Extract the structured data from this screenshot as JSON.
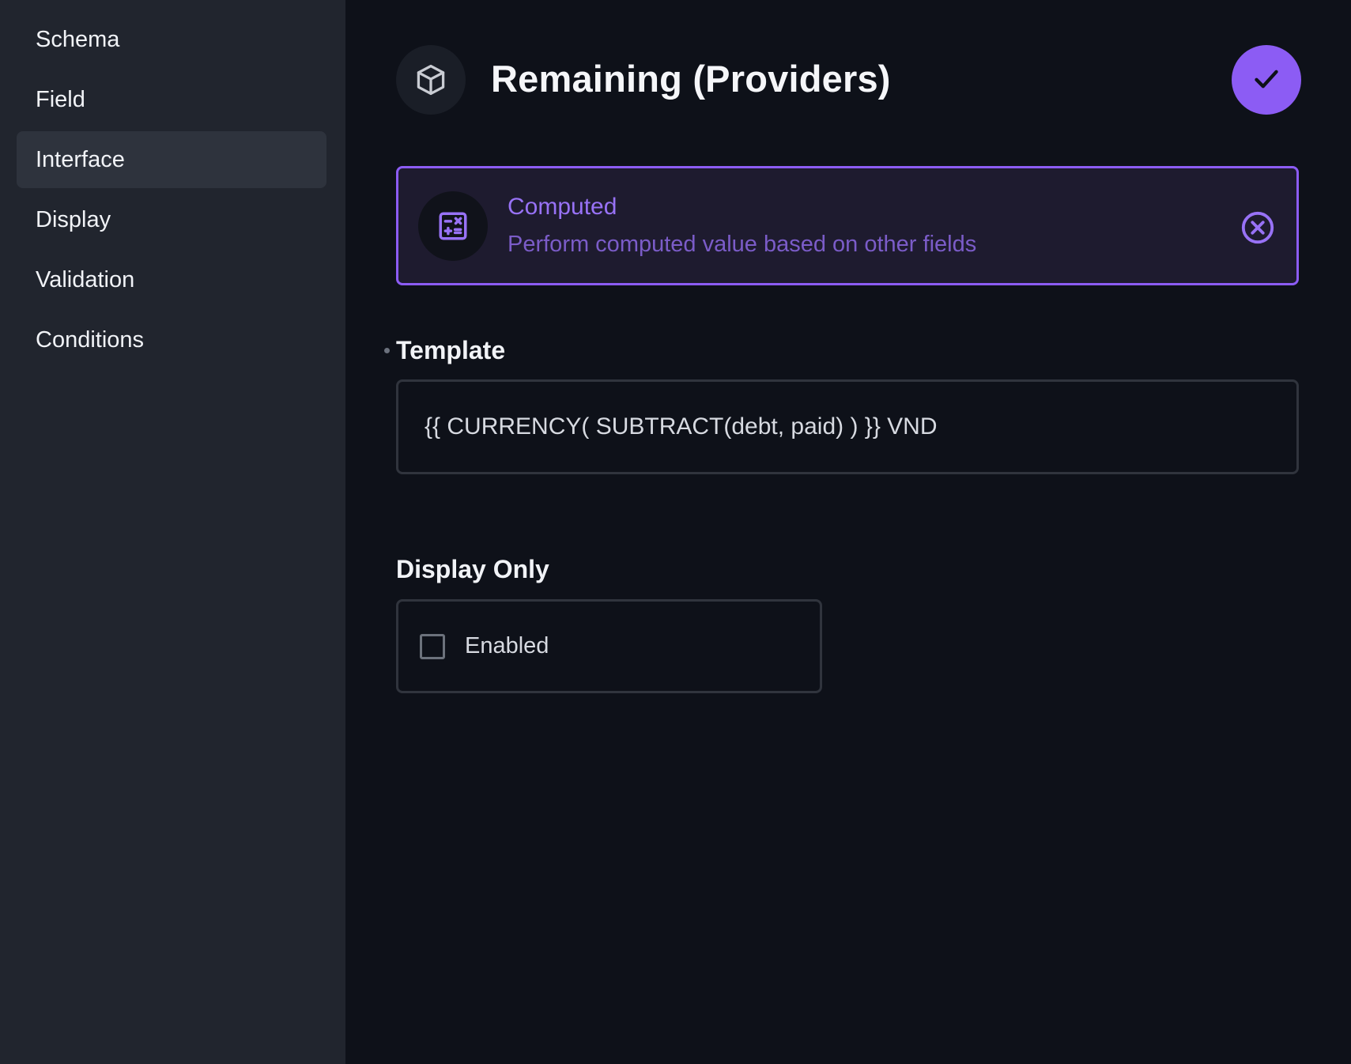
{
  "sidebar": {
    "items": [
      {
        "label": "Schema"
      },
      {
        "label": "Field"
      },
      {
        "label": "Interface",
        "active": true
      },
      {
        "label": "Display"
      },
      {
        "label": "Validation"
      },
      {
        "label": "Conditions"
      }
    ]
  },
  "header": {
    "icon": "box-icon",
    "title": "Remaining (Providers)",
    "save_icon": "check-icon"
  },
  "interface": {
    "icon": "calculator-icon",
    "name": "Computed",
    "description": "Perform computed value based on other fields",
    "clear_icon": "close-circle-icon"
  },
  "template_field": {
    "label": "Template",
    "value": "{{ CURRENCY( SUBTRACT(debt, paid) ) }} VND"
  },
  "display_only": {
    "label": "Display Only",
    "checkbox_label": "Enabled",
    "checked": false
  },
  "colors": {
    "accent": "#8c5cf4",
    "sidebar_bg": "#21252e",
    "main_bg": "#0e1119"
  }
}
